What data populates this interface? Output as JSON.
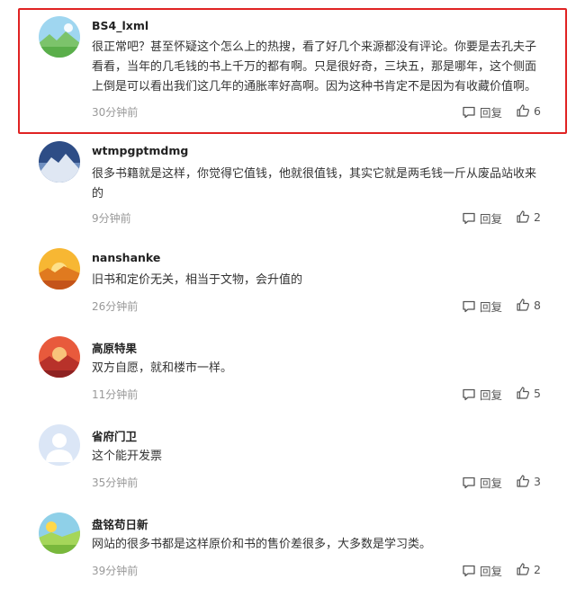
{
  "comments": [
    {
      "username": "BS4_lxml",
      "text": "很正常吧？甚至怀疑这个怎么上的热搜，看了好几个来源都没有评论。你要是去孔夫子看看，当年的几毛钱的书上千万的都有啊。只是很好奇，三块五，那是哪年，这个侧面上倒是可以看出我们这几年的通胀率好高啊。因为这种书肯定不是因为有收藏价值啊。",
      "time": "30分钟前",
      "reply_label": "回复",
      "like_count": "6"
    },
    {
      "username": "wtmpgptmdmg",
      "text": "很多书籍就是这样，你觉得它值钱，他就很值钱，其实它就是两毛钱一斤从废品站收来的",
      "time": "9分钟前",
      "reply_label": "回复",
      "like_count": "2"
    },
    {
      "username": "nanshanke",
      "text": "旧书和定价无关，相当于文物，会升值的",
      "time": "26分钟前",
      "reply_label": "回复",
      "like_count": "8"
    },
    {
      "username": "高原特果",
      "text": "双方自愿，就和楼市一样。",
      "time": "11分钟前",
      "reply_label": "回复",
      "like_count": "5"
    },
    {
      "username": "省府门卫",
      "text": "这个能开发票",
      "time": "35分钟前",
      "reply_label": "回复",
      "like_count": "3"
    },
    {
      "username": "盘铭苟日新",
      "text": "网站的很多书都是这样原价和书的售价差很多，大多数是学习类。",
      "time": "39分钟前",
      "reply_label": "回复",
      "like_count": "2"
    }
  ],
  "icons": {
    "reply": "comment-bubble-icon",
    "like": "thumbs-up-icon"
  },
  "colors": {
    "highlight_border": "#e02323",
    "meta_text": "#999999"
  }
}
